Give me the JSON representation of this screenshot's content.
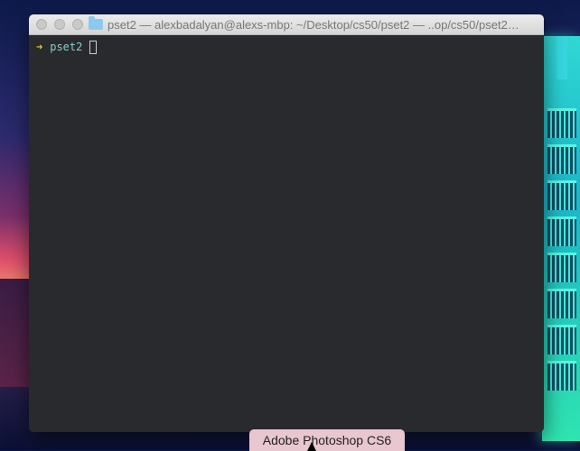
{
  "terminal": {
    "title": "pset2 — alexbadalyan@alexs-mbp: ~/Desktop/cs50/pset2 — ..op/cs50/pset2…",
    "prompt_symbol": "➜",
    "current_dir": "pset2"
  },
  "dock": {
    "tooltip": "Adobe Photoshop CS6"
  },
  "icons": {
    "window_controls": [
      "close-icon",
      "minimize-icon",
      "zoom-icon"
    ],
    "title_icon": "folder-icon"
  }
}
